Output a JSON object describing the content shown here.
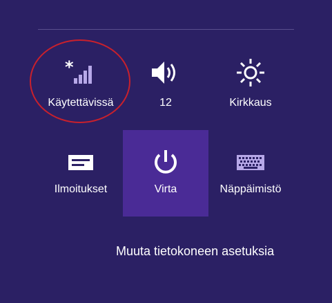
{
  "tiles": {
    "network": {
      "label": "Käytettävissä",
      "icon": "wifi-signal-available-icon"
    },
    "volume": {
      "label": "12",
      "icon": "speaker-volume-icon"
    },
    "brightness": {
      "label": "Kirkkaus",
      "icon": "brightness-sun-icon"
    },
    "notifications": {
      "label": "Ilmoitukset",
      "icon": "notifications-message-icon"
    },
    "power": {
      "label": "Virta",
      "icon": "power-icon"
    },
    "keyboard": {
      "label": "Näppäimistö",
      "icon": "keyboard-icon"
    }
  },
  "settings_link": {
    "label": "Muuta tietokoneen asetuksia"
  },
  "colors": {
    "background": "#2b2064",
    "highlight_tile": "#4a2b96",
    "icon_muted": "#b7a8e8",
    "annotation": "#c9202c"
  }
}
